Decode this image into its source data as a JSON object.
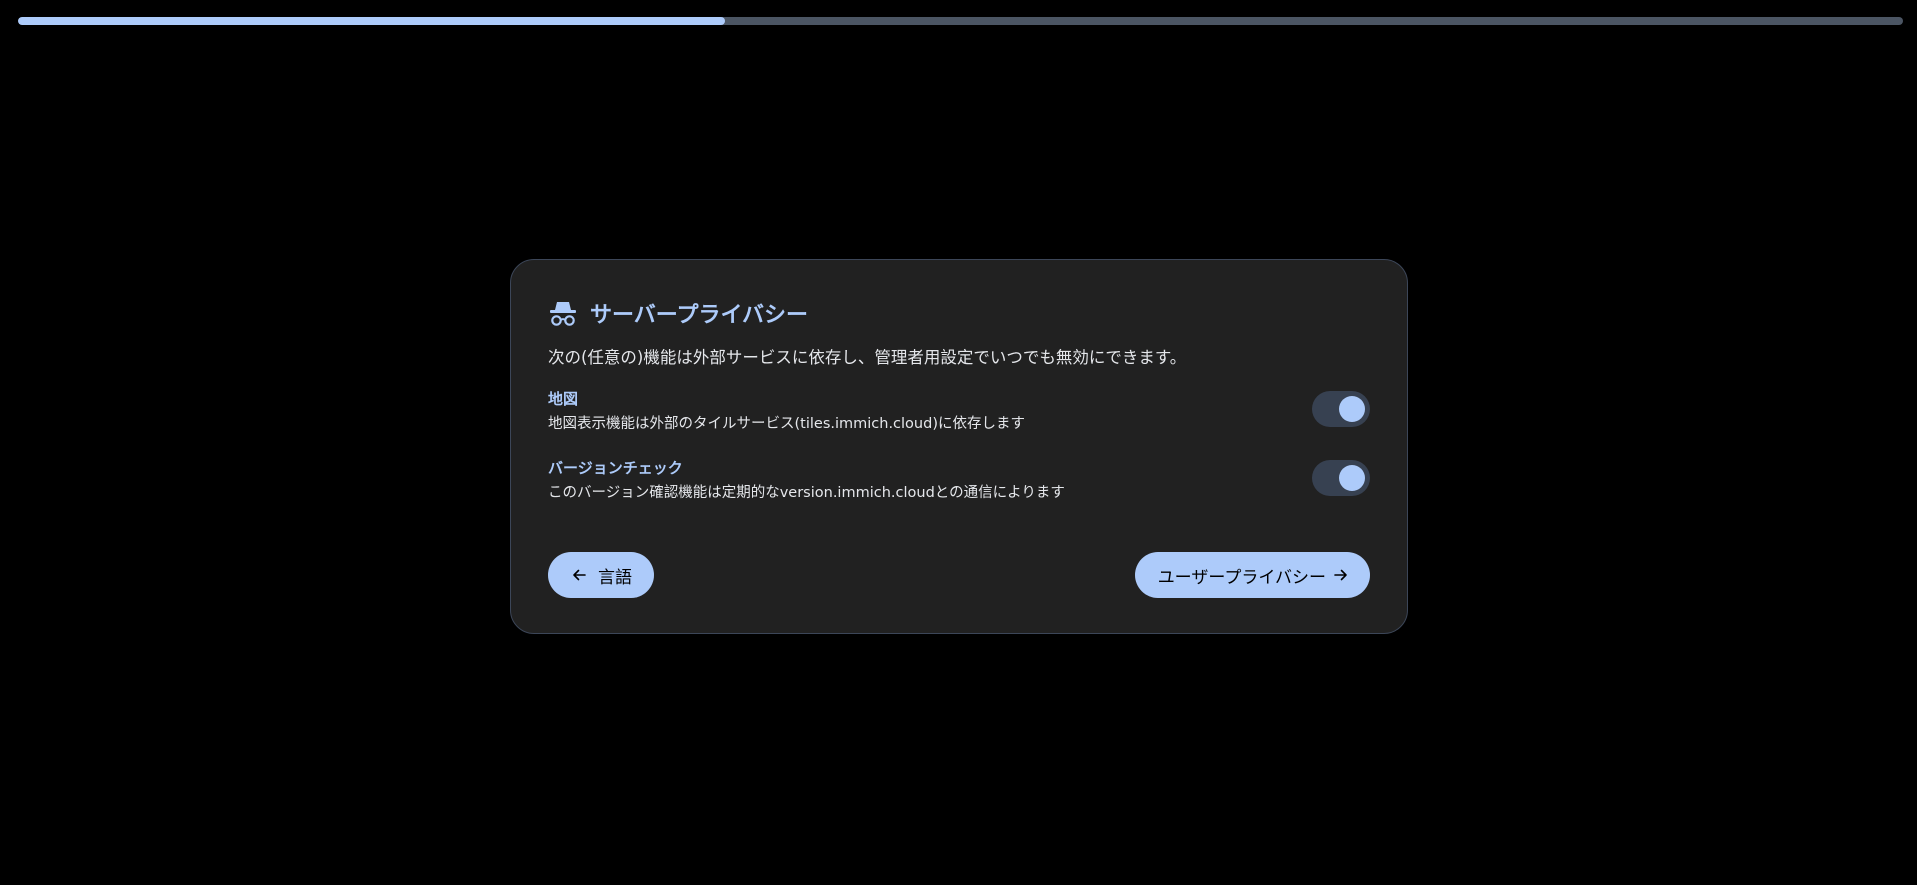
{
  "progress": {
    "fraction": 0.375,
    "fill_color": "#adcbfa",
    "track_color": "#4b5563"
  },
  "card": {
    "icon": "incognito-icon",
    "title": "サーバープライバシー",
    "description": "次の(任意の)機能は外部サービスに依存し、管理者用設定でいつでも無効にできます。",
    "settings": [
      {
        "title": "地図",
        "subtitle": "地図表示機能は外部のタイルサービス(tiles.immich.cloud)に依存します",
        "enabled": true
      },
      {
        "title": "バージョンチェック",
        "subtitle": "このバージョン確認機能は定期的なversion.immich.cloudとの通信によります",
        "enabled": true
      }
    ],
    "buttons": {
      "back_label": "言語",
      "back_icon": "arrow-left-icon",
      "next_label": "ユーザープライバシー",
      "next_icon": "arrow-right-icon"
    }
  },
  "colors": {
    "accent": "#adcbfa",
    "background": "#000000",
    "card_background": "#212121",
    "card_border": "#3c4658",
    "toggle_track": "#374151"
  }
}
